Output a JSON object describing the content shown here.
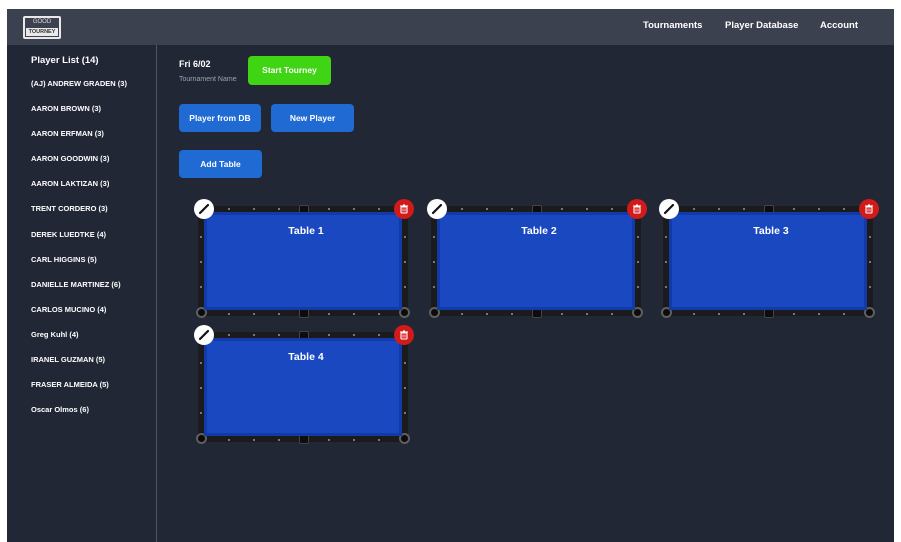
{
  "header": {
    "logo_top": "GOOD",
    "logo_bottom": "TOURNEY",
    "nav": [
      "Tournaments",
      "Player Database",
      "Account"
    ]
  },
  "sidebar": {
    "title": "Player List (14)",
    "players": [
      "(AJ) ANDREW GRADEN (3)",
      "AARON BROWN (3)",
      "AARON ERFMAN (3)",
      "AARON GOODWIN (3)",
      "AARON LAKTIZAN (3)",
      "TRENT CORDERO (3)",
      "DEREK LUEDTKE (4)",
      "CARL HIGGINS (5)",
      "DANIELLE MARTINEZ (6)",
      "CARLOS MUCINO (4)",
      "Greg Kuhl (4)",
      "IRANEL GUZMAN (5)",
      "FRASER ALMEIDA (5)",
      "Oscar Olmos (6)"
    ]
  },
  "tourney": {
    "date": "Fri 6/02",
    "name_placeholder": "Tournament Name",
    "start_label": "Start Tourney",
    "player_from_db_label": "Player from DB",
    "new_player_label": "New Player",
    "add_table_label": "Add Table"
  },
  "tables": [
    {
      "label": "Table 1"
    },
    {
      "label": "Table 2"
    },
    {
      "label": "Table 3"
    },
    {
      "label": "Table 4"
    }
  ],
  "colors": {
    "background": "#222736",
    "topbar": "#3c414f",
    "accent_blue": "#1f6ad3",
    "accent_green": "#3fd414",
    "felt": "#1a48c0",
    "delete_red": "#d11b1b"
  },
  "icons": {
    "edit": "pencil-icon",
    "delete": "trash-icon"
  }
}
